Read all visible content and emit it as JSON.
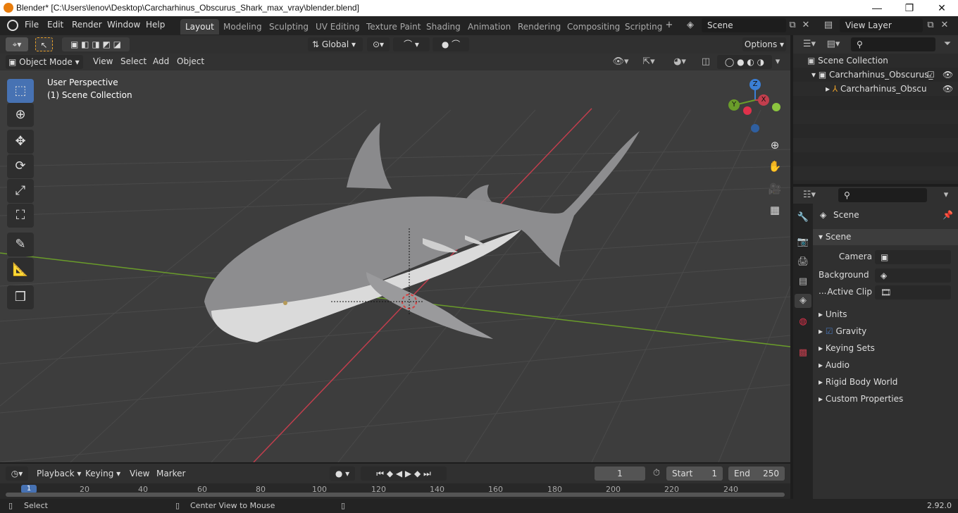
{
  "window": {
    "title": "Blender* [C:\\Users\\lenov\\Desktop\\Carcharhinus_Obscurus_Shark_max_vray\\blender.blend]",
    "min": "—",
    "max": "❐",
    "close": "✕"
  },
  "menu": [
    "File",
    "Edit",
    "Render",
    "Window",
    "Help"
  ],
  "workspaces": [
    {
      "label": "Layout",
      "active": true
    },
    {
      "label": "Modeling"
    },
    {
      "label": "Sculpting"
    },
    {
      "label": "UV Editing"
    },
    {
      "label": "Texture Paint"
    },
    {
      "label": "Shading"
    },
    {
      "label": "Animation"
    },
    {
      "label": "Rendering"
    },
    {
      "label": "Compositing"
    },
    {
      "label": "Scripting"
    }
  ],
  "scene_selector": "Scene",
  "view_layer_selector": "View Layer",
  "tool_header": {
    "orientation": "Global",
    "options": "Options"
  },
  "viewport_header": {
    "mode": "Object Mode",
    "menus": [
      "View",
      "Select",
      "Add",
      "Object"
    ]
  },
  "viewport": {
    "perspective": "User Perspective",
    "collection": "(1) Scene Collection"
  },
  "gizmo": {
    "z": "Z",
    "x": "X",
    "y": "Y"
  },
  "outliner": {
    "root": "Scene Collection",
    "collection": "Carcharhinus_Obscurus_",
    "object": "Carcharhinus_Obscu"
  },
  "properties": {
    "header": "Scene",
    "section": "Scene",
    "fields": [
      {
        "label": "Camera",
        "value": ""
      },
      {
        "label": "Background ...",
        "value": ""
      },
      {
        "label": "Active Clip",
        "value": ""
      }
    ],
    "panels": [
      "Units",
      "Gravity",
      "Keying Sets",
      "Audio",
      "Rigid Body World",
      "Custom Properties"
    ]
  },
  "timeline": {
    "menus": [
      "Playback",
      "Keying",
      "View",
      "Marker"
    ],
    "current_frame": "1",
    "start_label": "Start",
    "start": "1",
    "end_label": "End",
    "end": "250",
    "ticks": [
      "1",
      "20",
      "40",
      "60",
      "80",
      "100",
      "120",
      "140",
      "160",
      "180",
      "200",
      "220",
      "240"
    ]
  },
  "status": {
    "left": "Select",
    "middle": "Center View to Mouse",
    "version": "2.92.0"
  },
  "colors": {
    "accent": "#4772b3",
    "x_axis": "#c23e4d",
    "y_axis": "#6a9c2a",
    "z_axis": "#3b7fd6"
  }
}
